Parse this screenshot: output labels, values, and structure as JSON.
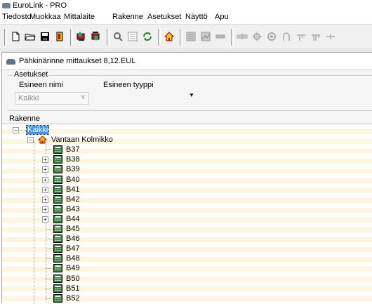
{
  "window": {
    "title": "EuroLink - PRO"
  },
  "menu": [
    "Tiedosto",
    "Muokkaa",
    "Mittalaite",
    "Rakenne",
    "Asetukset",
    "Näyttö",
    "Apu"
  ],
  "toolbar": {
    "groups": [
      [
        "new-file-icon",
        "open-folder-icon",
        "save-icon",
        "exit-door-icon"
      ],
      [
        "device-read-icon",
        "device-write-icon"
      ],
      [
        "search-icon",
        "list-icon",
        "refresh-icon"
      ],
      [
        "home-icon"
      ],
      [
        "meter-icon",
        "graph-icon",
        "battery-icon"
      ],
      [
        "pipe-icon",
        "valve-icon",
        "pump-icon",
        "arc-icon",
        "branch-icon",
        "branch-double-icon",
        "cross-icon"
      ]
    ]
  },
  "document": {
    "title": "Pähkinärinne mittaukset 8,12.EUL"
  },
  "settings": {
    "legend": "Asetukset",
    "object_name_label": "Esineen nimi",
    "object_type_label": "Esineen tyyppi",
    "object_name_value": "Kaikki"
  },
  "tree": {
    "label": "Rakenne",
    "root": {
      "label": "Kaikki",
      "selected": true
    },
    "site": {
      "label": "Vantaan Kolmikko"
    },
    "items": [
      {
        "label": "B37",
        "expandable": false
      },
      {
        "label": "B38",
        "expandable": true
      },
      {
        "label": "B39",
        "expandable": true
      },
      {
        "label": "B40",
        "expandable": true
      },
      {
        "label": "B41",
        "expandable": true
      },
      {
        "label": "B42",
        "expandable": true
      },
      {
        "label": "B43",
        "expandable": true
      },
      {
        "label": "B44",
        "expandable": true
      },
      {
        "label": "B45",
        "expandable": false
      },
      {
        "label": "B46",
        "expandable": false
      },
      {
        "label": "B47",
        "expandable": false
      },
      {
        "label": "B48",
        "expandable": false
      },
      {
        "label": "B49",
        "expandable": false
      },
      {
        "label": "B50",
        "expandable": false
      },
      {
        "label": "B51",
        "expandable": false
      },
      {
        "label": "B52",
        "expandable": false
      }
    ]
  },
  "colors": {
    "selection": "#3399ff",
    "tree_stripe": "#fbf6dc",
    "device_icon": "#2f7d34"
  }
}
